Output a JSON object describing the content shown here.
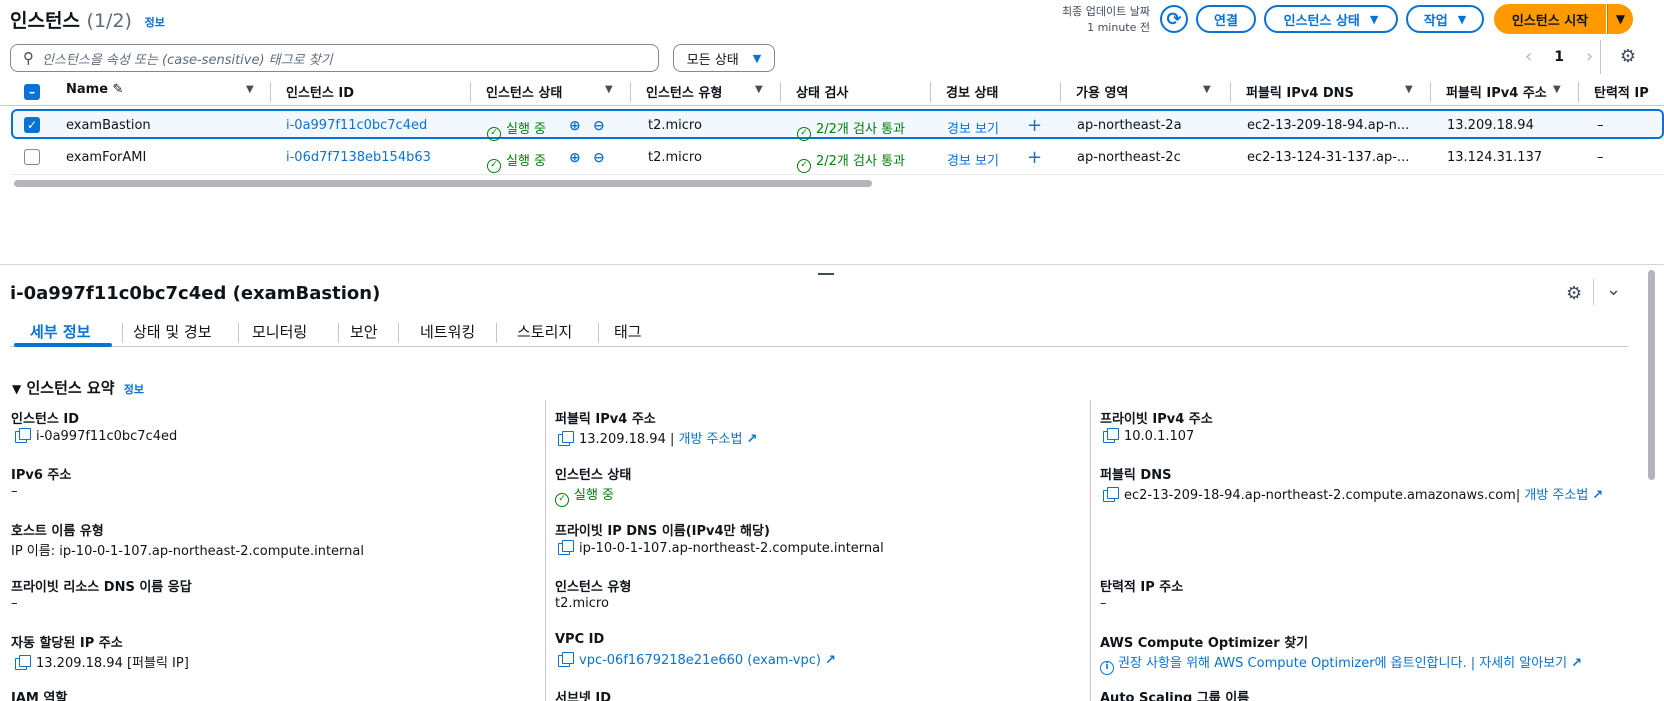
{
  "header": {
    "title": "인스턴스",
    "count": "(1/2)",
    "info_link": "정보",
    "last_updated_label": "최종 업데이트 날짜",
    "last_updated_value": "1 minute 전",
    "connect_label": "연결",
    "instance_state_label": "인스턴스 상태",
    "actions_label": "작업",
    "launch_label": "인스턴스 시작"
  },
  "filter": {
    "search_placeholder": "인스턴스을 속성 또는 (case-sensitive) 태그로 찾기",
    "state_filter": "모든 상태",
    "page": "1"
  },
  "table": {
    "columns": [
      "Name",
      "인스턴스 ID",
      "인스턴스 상태",
      "인스턴스 유형",
      "상태 검사",
      "경보 상태",
      "가용 영역",
      "퍼블릭 IPv4 DNS",
      "퍼블릭 IPv4 주소",
      "탄력적 IP"
    ],
    "rows": [
      {
        "name": "examBastion",
        "id": "i-0a997f11c0bc7c4ed",
        "state": "실행 중",
        "type": "t2.micro",
        "check": "2/2개 검사 통과",
        "alarm": "경보 보기",
        "az": "ap-northeast-2a",
        "dns": "ec2-13-209-18-94.ap-n...",
        "ip": "13.209.18.94",
        "eip": "–"
      },
      {
        "name": "examForAMI",
        "id": "i-06d7f7138eb154b63",
        "state": "실행 중",
        "type": "t2.micro",
        "check": "2/2개 검사 통과",
        "alarm": "경보 보기",
        "az": "ap-northeast-2c",
        "dns": "ec2-13-124-31-137.ap-...",
        "ip": "13.124.31.137",
        "eip": "–"
      }
    ]
  },
  "detail": {
    "title": "i-0a997f11c0bc7c4ed (examBastion)",
    "tabs": [
      "세부 정보",
      "상태 및 경보",
      "모니터링",
      "보안",
      "네트워킹",
      "스토리지",
      "태그"
    ],
    "section_title": "인스턴스 요약",
    "section_info": "정보",
    "fields": {
      "instance_id_k": "인스턴스 ID",
      "instance_id_v": "i-0a997f11c0bc7c4ed",
      "ipv6_k": "IPv6 주소",
      "ipv6_v": "–",
      "hostname_type_k": "호스트 이름 유형",
      "hostname_type_v": "IP 이름: ip-10-0-1-107.ap-northeast-2.compute.internal",
      "private_dns_resp_k": "프라이빗 리소스 DNS 이름 응답",
      "private_dns_resp_v": "–",
      "auto_ip_k": "자동 할당된 IP 주소",
      "auto_ip_v": "13.209.18.94 [퍼블릭 IP]",
      "iam_k": "IAM 역할",
      "public_ipv4_k": "퍼블릭 IPv4 주소",
      "public_ipv4_v": "13.209.18.94 |",
      "open_addr_link": "개방 주소법",
      "state_k": "인스턴스 상태",
      "state_v": "실행 중",
      "private_ip_dns_k": "프라이빗 IP DNS 이름(IPv4만 해당)",
      "private_ip_dns_v": "ip-10-0-1-107.ap-northeast-2.compute.internal",
      "type_k": "인스턴스 유형",
      "type_v": "t2.micro",
      "vpc_k": "VPC ID",
      "vpc_v": "vpc-06f1679218e21e660 (exam-vpc)",
      "subnet_k": "서브넷 ID",
      "private_ipv4_k": "프라이빗 IPv4 주소",
      "private_ipv4_v": "10.0.1.107",
      "public_dns_k": "퍼블릭 DNS",
      "public_dns_v": "ec2-13-209-18-94.ap-northeast-2.compute.amazonaws.com|",
      "eip_k": "탄력적 IP 주소",
      "eip_v": "–",
      "optimizer_k": "AWS Compute Optimizer 찾기",
      "optimizer_v": "권장 사항을 위해 AWS Compute Optimizer에 옵트인합니다. |",
      "learn_more": "자세히 알아보기",
      "asg_k": "Auto Scaling 그룹 이름"
    }
  },
  "colors": {
    "accent": "#0972d3",
    "primary": "#ff9900",
    "success": "#037f0c"
  }
}
